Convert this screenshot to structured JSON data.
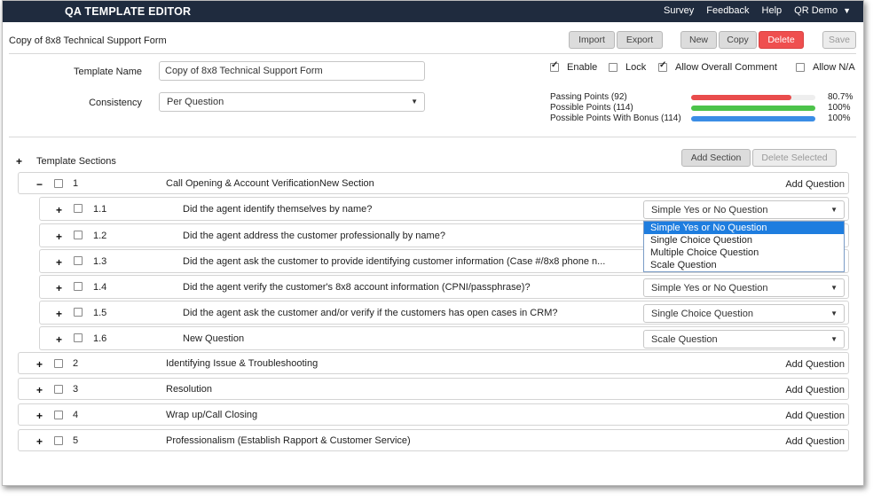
{
  "app": {
    "title": "QA TEMPLATE EDITOR",
    "nav": [
      "Survey",
      "Feedback",
      "Help",
      "QR Demo"
    ]
  },
  "header": {
    "form_title": "Copy of 8x8 Technical Support Form",
    "buttons": {
      "import": "Import",
      "export": "Export",
      "new": "New",
      "copy": "Copy",
      "delete": "Delete",
      "save": "Save"
    }
  },
  "form": {
    "template_name_label": "Template Name",
    "template_name_value": "Copy of 8x8 Technical Support Form",
    "consistency_label": "Consistency",
    "consistency_value": "Per Question",
    "options": [
      {
        "label": "Enable",
        "checked": true
      },
      {
        "label": "Lock",
        "checked": false
      },
      {
        "label": "Allow Overall Comment",
        "checked": true
      },
      {
        "label": "Allow N/A",
        "checked": false
      }
    ]
  },
  "points": [
    {
      "label": "Passing Points (92)",
      "pct": "80.7%",
      "fraction": 0.807,
      "color": "#e94c4c"
    },
    {
      "label": "Possible Points (114)",
      "pct": "100%",
      "fraction": 1.0,
      "color": "#4cc34a"
    },
    {
      "label": "Possible Points With Bonus (114)",
      "pct": "100%",
      "fraction": 1.0,
      "color": "#3a8de6"
    }
  ],
  "sections_panel": {
    "label": "Template Sections",
    "add_section": "Add Section",
    "delete_selected": "Delete Selected",
    "add_question": "Add Question"
  },
  "sections": [
    {
      "num": "1",
      "title": "Call Opening & Account VerificationNew Section",
      "expanded": true
    },
    {
      "num": "2",
      "title": "Identifying Issue & Troubleshooting",
      "expanded": false
    },
    {
      "num": "3",
      "title": "Resolution",
      "expanded": false
    },
    {
      "num": "4",
      "title": "Wrap up/Call Closing",
      "expanded": false
    },
    {
      "num": "5",
      "title": "Professionalism (Establish Rapport & Customer Service)",
      "expanded": false
    }
  ],
  "questions": [
    {
      "num": "1.1",
      "text": "Did the agent identify themselves by name?",
      "type": "Simple Yes or No Question"
    },
    {
      "num": "1.2",
      "text": "Did the agent address the customer professionally by name?",
      "type": ""
    },
    {
      "num": "1.3",
      "text": "Did the agent ask the customer to provide identifying customer information (Case #/8x8 phone n...",
      "type": ""
    },
    {
      "num": "1.4",
      "text": "Did the agent verify the customer's 8x8 account information (CPNI/passphrase)?",
      "type": "Simple Yes or No Question"
    },
    {
      "num": "1.5",
      "text": "Did the agent ask the customer and/or verify if the customers has open cases in CRM?",
      "type": "Single Choice Question"
    },
    {
      "num": "1.6",
      "text": "New Question",
      "type": "Scale Question"
    }
  ],
  "question_type_options": [
    "Simple Yes or No Question",
    "Single Choice Question",
    "Multiple Choice Question",
    "Scale Question"
  ],
  "question_type_selected_index": 0
}
